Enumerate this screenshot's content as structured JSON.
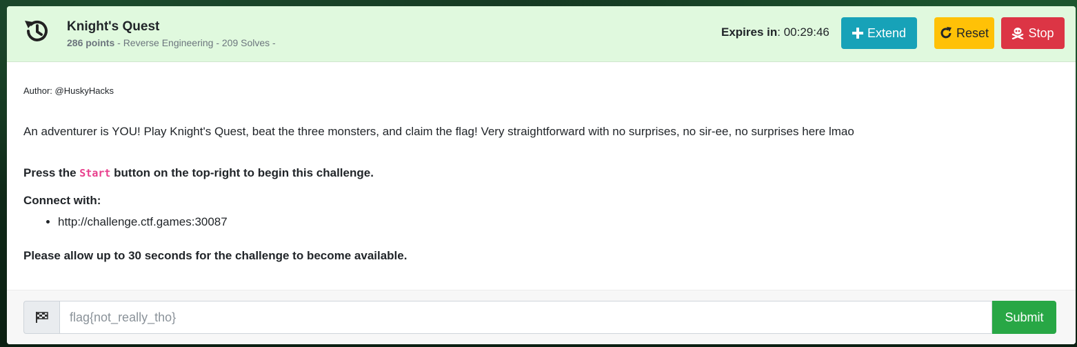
{
  "header": {
    "icon": "history-icon",
    "title": "Knight's Quest",
    "points": "286 points",
    "meta": " - Reverse Engineering - 209 Solves -",
    "expires_label": "Expires in",
    "expires_value": ": 00:29:46",
    "buttons": {
      "extend": {
        "label": "Extend",
        "icon": "plus-icon",
        "color": "#17a2b8"
      },
      "reset": {
        "label": "Reset",
        "icon": "redo-icon",
        "color": "#ffc107"
      },
      "stop": {
        "label": "Stop",
        "icon": "skull-crossbones-icon",
        "color": "#dc3545"
      }
    },
    "background": "#e0f9de"
  },
  "body": {
    "author": "Author: @HuskyHacks",
    "description": "An adventurer is YOU! Play Knight's Quest, beat the three monsters, and claim the flag! Very straightforward with no surprises, no sir-ee, no surprises here lmao",
    "press_prefix": "Press the ",
    "press_code": "Start",
    "press_suffix": " button on the top-right to begin this challenge.",
    "connect_label": "Connect with:",
    "connect_items": [
      "http://challenge.ctf.games:30087"
    ],
    "allow_text": "Please allow up to 30 seconds for the challenge to become available."
  },
  "footer": {
    "flag_icon": "flag-checkered-icon",
    "placeholder": "flag{not_really_tho}",
    "value": "",
    "submit_label": "Submit",
    "submit_color": "#28a745"
  }
}
